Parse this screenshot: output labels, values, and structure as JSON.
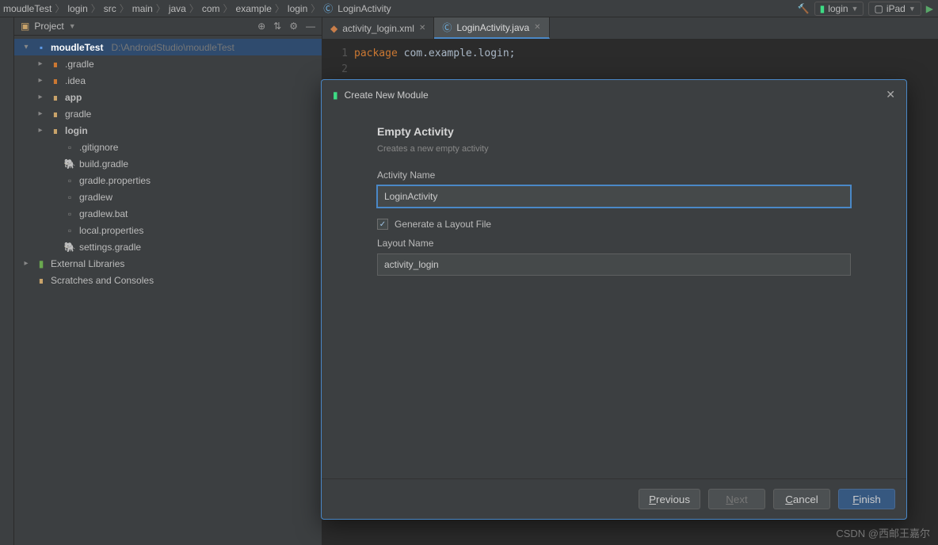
{
  "breadcrumb": [
    "moudleTest",
    "login",
    "src",
    "main",
    "java",
    "com",
    "example",
    "login",
    "LoginActivity"
  ],
  "toolbar": {
    "login": "login",
    "ipad": "iPad"
  },
  "panel": {
    "title": "Project"
  },
  "tree": {
    "root": "moudleTest",
    "root_hint": "D:\\AndroidStudio\\moudleTest",
    "gradle_dir": ".gradle",
    "idea_dir": ".idea",
    "app": "app",
    "gradle": "gradle",
    "login": "login",
    "gitignore": ".gitignore",
    "build_gradle": "build.gradle",
    "gradle_props": "gradle.properties",
    "gradlew": "gradlew",
    "gradlew_bat": "gradlew.bat",
    "local_props": "local.properties",
    "settings_gradle": "settings.gradle",
    "ext_libs": "External Libraries",
    "scratches": "Scratches and Consoles"
  },
  "tabs": [
    {
      "name": "activity_login.xml"
    },
    {
      "name": "LoginActivity.java"
    }
  ],
  "code": {
    "line1_kw": "package",
    "line1_rest": " com.example.login;"
  },
  "dialog": {
    "title": "Create New Module",
    "heading": "Empty Activity",
    "subtitle": "Creates a new empty activity",
    "activity_name_label": "Activity Name",
    "activity_name_value": "LoginActivity",
    "generate_layout": "Generate a Layout File",
    "layout_name_label": "Layout Name",
    "layout_name_value": "activity_login",
    "previous": "Previous",
    "next": "Next",
    "cancel": "Cancel",
    "finish": "Finish"
  },
  "watermark": "CSDN @西邮王嘉尔"
}
